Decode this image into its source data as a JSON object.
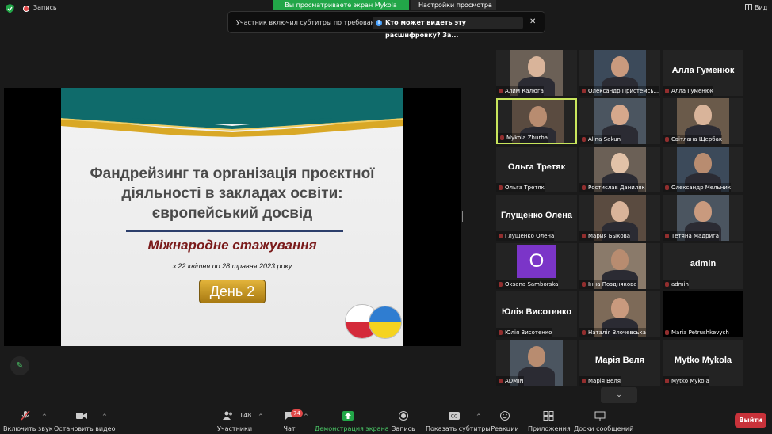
{
  "topbar": {
    "record_label": "Запись",
    "viewing_banner": "Вы просматриваете экран Mykola Zhurba",
    "view_settings_label": "Настройки просмотра",
    "view_label": "Вид"
  },
  "caption_notice": {
    "message": "Участник включил субтитры по требованию",
    "who_can_see": "Кто может видеть эту расшифровку? За..."
  },
  "slide": {
    "title_lines": [
      "Фандрейзинг  та  організація  проєктної",
      "діяльності в закладах освіти:",
      "європейський досвід"
    ],
    "subtitle": "Міжнародне стажування",
    "dates": "з 22 квітня по 28 травня 2023 року",
    "day_button": "День 2"
  },
  "participants": [
    {
      "name": "Алим Калюга",
      "big": "",
      "photo": true
    },
    {
      "name": "Олександр Пристемсь...",
      "big": "",
      "photo": true
    },
    {
      "name": "Алла Гуменюк",
      "big": "Алла Гуменюк",
      "photo": false
    },
    {
      "name": "Mykola Zhurba",
      "big": "",
      "photo": true,
      "active": true
    },
    {
      "name": "Alina Sakun",
      "big": "",
      "photo": true
    },
    {
      "name": "Світлана Щербак",
      "big": "",
      "photo": true
    },
    {
      "name": "Ольга Третяк",
      "big": "Ольга Третяк",
      "photo": false
    },
    {
      "name": "Ростислав Даниляк",
      "big": "",
      "photo": true
    },
    {
      "name": "Олександр Мельник",
      "big": "",
      "photo": true
    },
    {
      "name": "Глущенко Олена",
      "big": "Глущенко Олена",
      "photo": false
    },
    {
      "name": "Мария Быкова",
      "big": "",
      "photo": true
    },
    {
      "name": "Тетяна Мадрига",
      "big": "",
      "photo": true
    },
    {
      "name": "Oksana Samborska",
      "big": "O",
      "photo": false,
      "avatar": true
    },
    {
      "name": "Інна Позднякова",
      "big": "",
      "photo": true
    },
    {
      "name": "admin",
      "big": "admin",
      "photo": false
    },
    {
      "name": "Юлія Висотенко",
      "big": "Юлія Висотенко",
      "photo": false
    },
    {
      "name": "Наталія Злочевська",
      "big": "",
      "photo": true
    },
    {
      "name": "Maria Petrushkevych",
      "big": "",
      "photo": false,
      "black": true
    },
    {
      "name": "ADMIN",
      "big": "",
      "photo": true
    },
    {
      "name": "Марія Веля",
      "big": "Марія Веля",
      "photo": false
    },
    {
      "name": "Mytko Mykola",
      "big": "Mytko Mykola",
      "photo": false
    }
  ],
  "toolbar": {
    "unmute": "Включить звук",
    "stop_video": "Остановить видео",
    "participants": "Участники",
    "participants_count": "148",
    "chat": "Чат",
    "chat_badge": "74",
    "share_screen": "Демонстрация экрана",
    "record": "Запись",
    "captions": "Показать субтитры",
    "reactions": "Реакции",
    "apps": "Приложения",
    "whiteboards": "Доски сообщений",
    "leave": "Выйти"
  },
  "colors": {
    "accent_green": "#22a648",
    "leave_red": "#c8323a",
    "active_speaker": "#c8e55c"
  }
}
